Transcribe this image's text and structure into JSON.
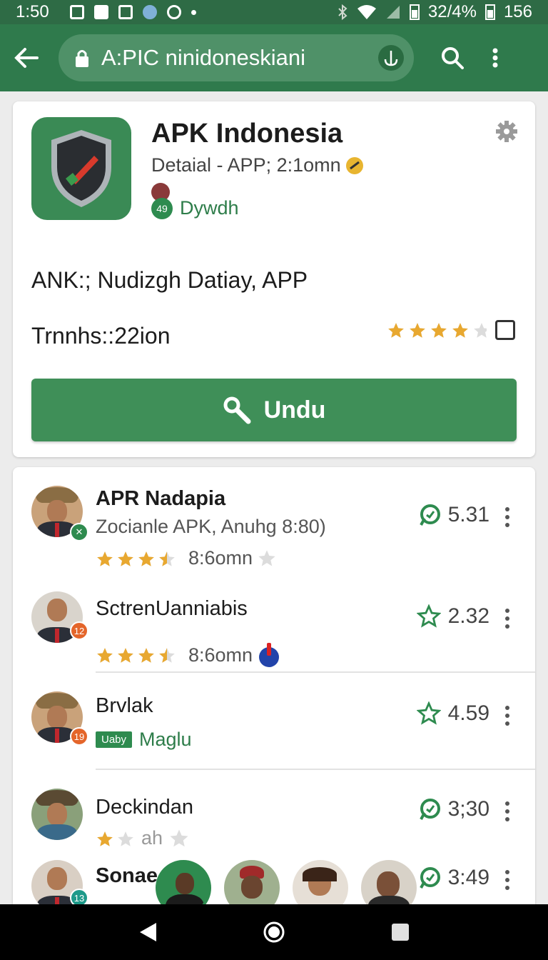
{
  "status_bar": {
    "time": "1:50",
    "battery_text": "32/4%",
    "extra_text": "156"
  },
  "toolbar": {
    "url": "A:PIC ninidoneskiani"
  },
  "app": {
    "title": "APK Indonesia",
    "subtitle": "Detaial - APP; 2:1omn",
    "developer_badge": "49",
    "developer": "Dywdh",
    "description": "ANK:; Nudizgh Datiay, APP",
    "translation": "Trnnhs::22ion",
    "rating_stars": 4,
    "install_label": "Undu"
  },
  "list": [
    {
      "name": "APR Nadapia",
      "bold": true,
      "subtitle": "Zocianle APK, Anuhg 8:80)",
      "stars": 3.5,
      "meta": "8:6omn",
      "score": "5.31",
      "score_icon": "chat-icon",
      "badge": "✕"
    },
    {
      "name": "SctrenUanniabis",
      "stars": 3.5,
      "meta": "8:6omn",
      "score": "2.32",
      "score_icon": "star-outline-icon",
      "badge": "12"
    },
    {
      "name": "Brvlak",
      "tag": "Uaby",
      "meta": "Maglu",
      "score": "4.59",
      "score_icon": "star-outline-icon",
      "badge": "19"
    },
    {
      "name": "Deckindan",
      "stars": 1,
      "meta": "ah",
      "score": "3;30",
      "score_icon": "chat-icon"
    },
    {
      "name": "Sonae",
      "bold": true,
      "score": "3:49",
      "score_icon": "chat-icon",
      "badge": "13"
    }
  ],
  "colors": {
    "primary": "#2f7a4c",
    "status_bar": "#2e6b45",
    "accent_green": "#3f8f58",
    "star_gold": "#e8a830"
  }
}
